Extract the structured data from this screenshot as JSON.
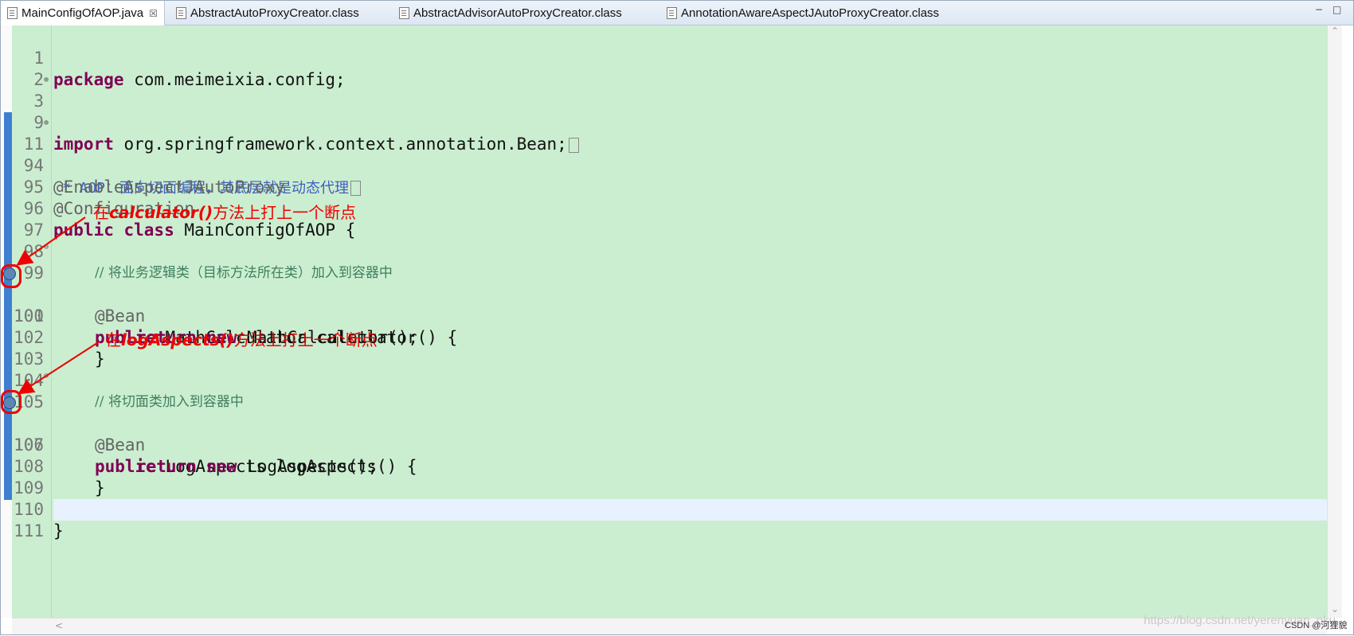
{
  "tabs": [
    {
      "label": "MainConfigOfAOP.java",
      "close": "☒",
      "icon": "java-file-icon"
    },
    {
      "label": "AbstractAutoProxyCreator.class",
      "icon": "class-file-icon"
    },
    {
      "label": "AbstractAdvisorAutoProxyCreator.class",
      "icon": "class-file-icon"
    },
    {
      "label": "AnnotationAwareAspectJAutoProxyCreator.class",
      "icon": "class-file-icon"
    }
  ],
  "window_controls": {
    "minimize": "−",
    "maximize": "□"
  },
  "lines": [
    {
      "num": "1"
    },
    {
      "num": "2"
    },
    {
      "num": "3"
    },
    {
      "num": "9"
    },
    {
      "num": "11"
    },
    {
      "num": "94"
    },
    {
      "num": "95"
    },
    {
      "num": "96"
    },
    {
      "num": "97"
    },
    {
      "num": "98"
    },
    {
      "num": "99"
    },
    {
      "num": "100"
    },
    {
      "num": "101"
    },
    {
      "num": "102"
    },
    {
      "num": "103"
    },
    {
      "num": "104"
    },
    {
      "num": "105"
    },
    {
      "num": "106"
    },
    {
      "num": "107"
    },
    {
      "num": "108"
    },
    {
      "num": "109"
    },
    {
      "num": "110"
    },
    {
      "num": "111"
    }
  ],
  "code": {
    "l1_kw": "package",
    "l1_rest": " com.meimeixia.config;",
    "l3_kw": "import",
    "l3_rest": " org.springframework.context.annotation.Bean;",
    "l11": " * AOP：面向切面编程，其底层就是动态代理",
    "l94": "@EnableAspectJAutoProxy",
    "l95": "@Configuration",
    "l96_kw": "public class",
    "l96_rest": " MainConfigOfAOP {",
    "l98": "// 将业务逻辑类（目标方法所在类）加入到容器中",
    "l99": "@Bean",
    "l100_kw": "public",
    "l100_rest": " MathCalculator calculator() {",
    "l101_kw": "return new",
    "l101_rest": " MathCalculator();",
    "l102": "}",
    "l104": "// 将切面类加入到容器中",
    "l105": "@Bean",
    "l106_kw": "public",
    "l106_rest": " LogAspects logAspects() {",
    "l107_kw": "return new",
    "l107_rest": " LogAspects();",
    "l108": "}",
    "l110": "}"
  },
  "annotations": {
    "note1_pre": "在",
    "note1_em": "calculator()",
    "note1_post": "方法上打上一个断点",
    "note2_pre": "在",
    "note2_em": "logAspects()",
    "note2_post": "方法上打上一个断点",
    "color": "#e00000"
  },
  "watermark": "https://blog.csdn.net/yerenyuan_pku",
  "csdn_label": "CSDN @河狸貌",
  "colors": {
    "editor_bg": "#cbeed0",
    "keyword": "#7f0055",
    "comment": "#3f7f5f",
    "javadoc": "#3f5fbf"
  }
}
